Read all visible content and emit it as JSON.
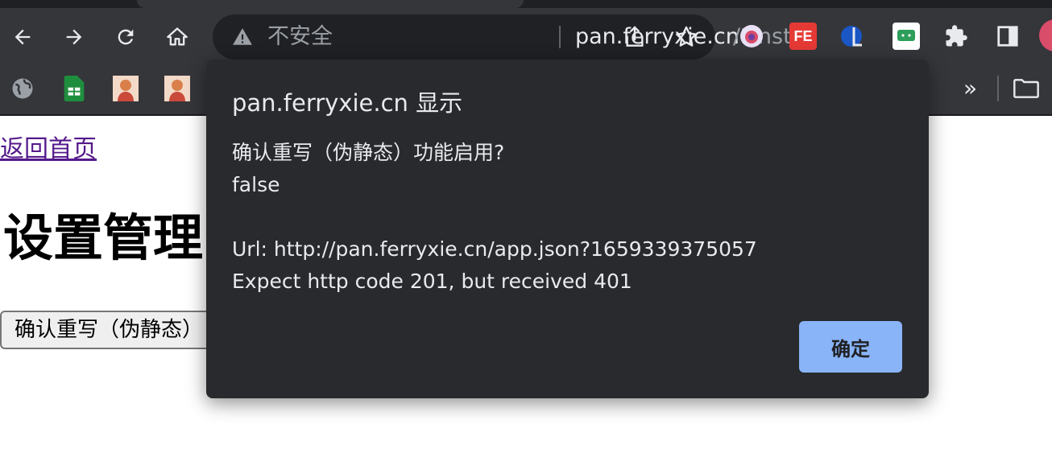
{
  "browser": {
    "omnibox": {
      "security_label": "不安全",
      "url_host": "pan.ferryxie.cn",
      "url_rest": "/?inst..."
    },
    "bookmarks": {
      "more": "»"
    },
    "colors": {
      "chrome_bg": "#35363a",
      "omnibox_bg": "#202124",
      "accent": "#8ab4f8"
    }
  },
  "page": {
    "home_link": "返回首页",
    "title": "设置管理",
    "rewrite_button": "确认重写（伪静态）"
  },
  "dialog": {
    "title": "pan.ferryxie.cn 显示",
    "message": "确认重写（伪静态）功能启用?\nfalse\n\nUrl: http://pan.ferryxie.cn/app.json?1659339375057\nExpect http code 201, but received 401",
    "ok_label": "确定"
  }
}
